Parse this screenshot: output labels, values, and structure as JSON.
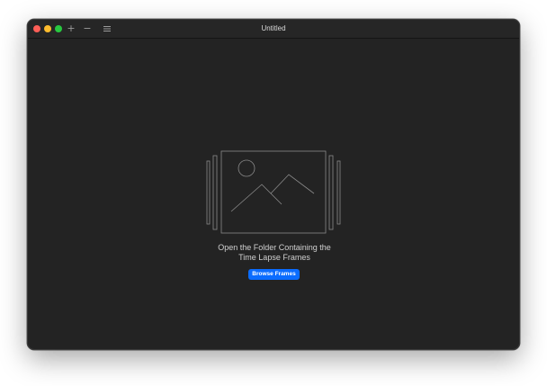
{
  "window": {
    "title": "Untitled"
  },
  "toolbar": {
    "add_icon": "plus-icon",
    "remove_icon": "minus-icon",
    "list_icon": "list-icon"
  },
  "main": {
    "prompt_line1": "Open the Folder Containing the",
    "prompt_line2": "Time Lapse Frames",
    "browse_label": "Browse Frames",
    "illustration_icon": "image-frames-icon"
  },
  "colors": {
    "accent": "#0a6cff",
    "background": "#232323",
    "close": "#fe5f57",
    "minimize": "#febc2e",
    "maximize": "#28c840"
  }
}
